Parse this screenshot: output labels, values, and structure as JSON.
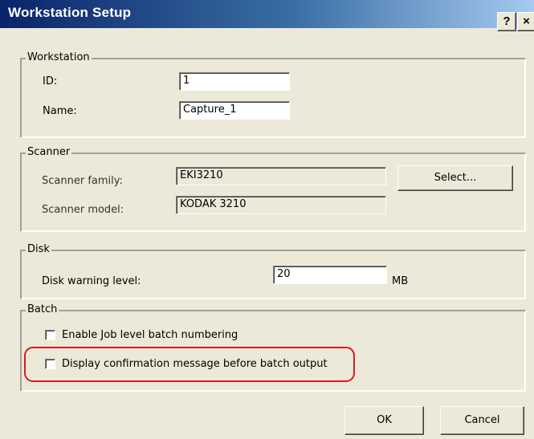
{
  "window": {
    "title": "Workstation Setup",
    "help_label": "?",
    "close_label": "×"
  },
  "workstation": {
    "group_label": "Workstation",
    "id_label": "ID:",
    "id_value": "1",
    "name_label": "Name:",
    "name_value": "Capture_1"
  },
  "scanner": {
    "group_label": "Scanner",
    "family_label": "Scanner family:",
    "family_value": "EKI3210",
    "model_label": "Scanner model:",
    "model_value": "KODAK 3210",
    "select_label": "Select..."
  },
  "disk": {
    "group_label": "Disk",
    "warning_label": "Disk warning level:",
    "warning_value": "20",
    "unit": "MB"
  },
  "batch": {
    "group_label": "Batch",
    "job_numbering_label": "Enable Job level batch numbering",
    "job_numbering_checked": false,
    "confirm_label": "Display confirmation message before batch output",
    "confirm_checked": false
  },
  "buttons": {
    "ok_label": "OK",
    "cancel_label": "Cancel"
  },
  "colors": {
    "titlebar_start": "#0a246a",
    "titlebar_end": "#a6caf0",
    "face": "#ece9d8",
    "highlight": "#e0191e"
  }
}
